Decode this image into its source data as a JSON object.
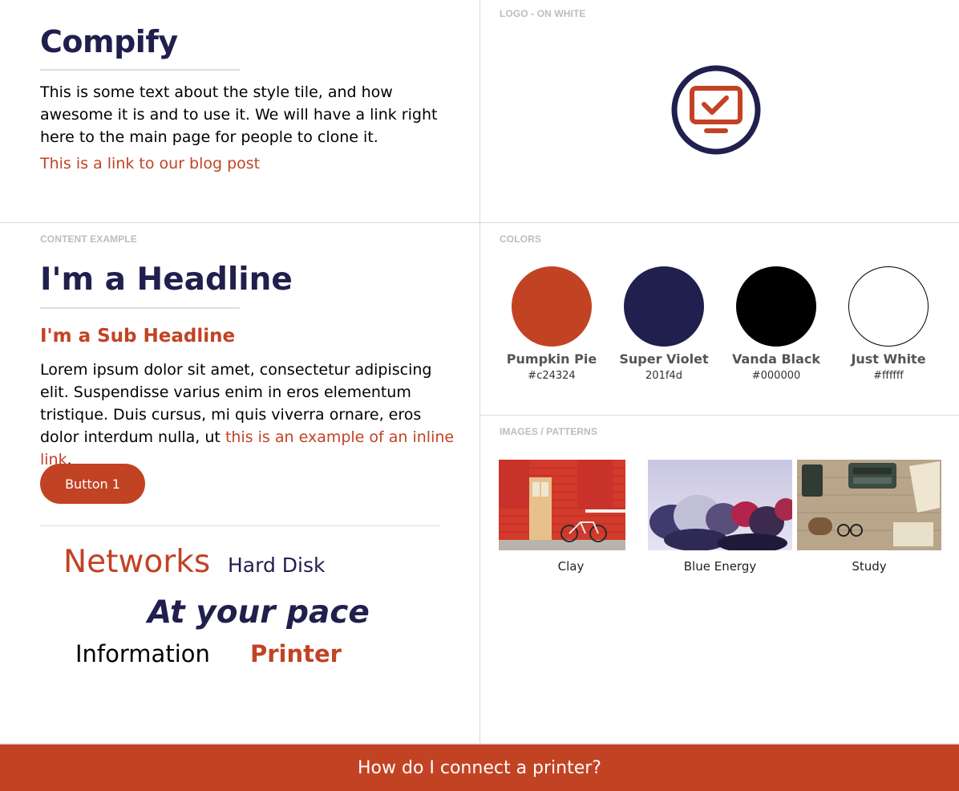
{
  "intro": {
    "brand": "Compify",
    "text": "This is some text about the style tile, and how awesome it is and to use it. We will have a link right here to the main page for people to clone it.",
    "link": "This is a link to our blog post"
  },
  "logo_section": {
    "label": "LOGO - ON WHITE"
  },
  "content_example": {
    "label": "CONTENT EXAMPLE",
    "headline": "I'm a Headline",
    "subheadline": "I'm a Sub Headline",
    "body": "Lorem ipsum dolor sit amet, consectetur adipiscing elit. Suspendisse varius enim in eros elementum tristique. Duis cursus, mi quis viverra ornare, eros dolor interdum nulla, ut ",
    "inline_link": "this is an example of an inline link",
    "body_end": ".",
    "button": "Button 1",
    "words": [
      "Networks",
      "Hard Disk",
      "At your pace",
      "Information",
      "Printer"
    ]
  },
  "colors": {
    "label": "COLORS",
    "swatches": [
      {
        "name": "Pumpkin Pie",
        "hex": "#c24324",
        "color": "#c24324"
      },
      {
        "name": "Super Violet",
        "hex": "201f4d",
        "color": "#201f4d"
      },
      {
        "name": "Vanda Black",
        "hex": "#000000",
        "color": "#000000"
      },
      {
        "name": "Just White",
        "hex": "#ffffff",
        "color": "#ffffff"
      }
    ]
  },
  "images": {
    "label": "IMAGES / PATTERNS",
    "items": [
      {
        "label": "Clay"
      },
      {
        "label": "Blue Energy"
      },
      {
        "label": "Study"
      }
    ]
  },
  "footer": {
    "text": "How do I connect a printer?"
  },
  "theme": {
    "accent": "#c24324",
    "violet": "#201f4d"
  }
}
